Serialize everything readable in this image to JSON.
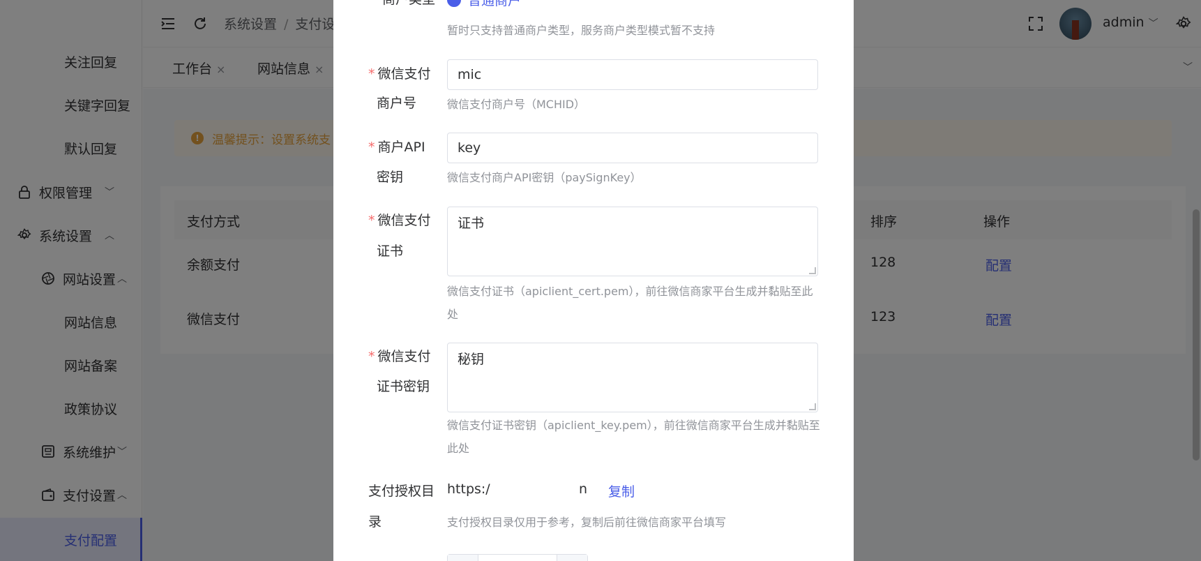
{
  "sidebar": {
    "items": [
      {
        "label": "关注回复"
      },
      {
        "label": "关键字回复"
      },
      {
        "label": "默认回复"
      },
      {
        "label": "权限管理"
      },
      {
        "label": "系统设置"
      },
      {
        "label": "网站设置"
      },
      {
        "label": "网站信息"
      },
      {
        "label": "网站备案"
      },
      {
        "label": "政策协议"
      },
      {
        "label": "系统维护"
      },
      {
        "label": "支付设置"
      },
      {
        "label": "支付配置"
      }
    ]
  },
  "header": {
    "breadcrumb": [
      "系统设置",
      "支付设"
    ],
    "breadcrumb_sep": "/",
    "user": "admin",
    "user_chevron": "﹀"
  },
  "tabs": [
    {
      "label": "工作台"
    },
    {
      "label": "网站信息"
    }
  ],
  "tab_close": "×",
  "alert": {
    "icon": "!",
    "text": "温馨提示：设置系统支"
  },
  "table": {
    "headers": {
      "method": "支付方式",
      "sort": "排序",
      "action": "操作"
    },
    "rows": [
      {
        "method": "余额支付",
        "sort": "128",
        "action": "配置"
      },
      {
        "method": "微信支付",
        "sort": "123",
        "action": "配置"
      }
    ]
  },
  "dialog": {
    "merchant_type": {
      "label": "商户类型",
      "option": "普通商户",
      "tip": "暂时只支持普通商户类型，服务商户类型模式暂不支持"
    },
    "required_mark": "*",
    "mchid": {
      "label_1": "微信支付",
      "label_2": "商户号",
      "value": "mic",
      "tip": "微信支付商户号（MCHID）"
    },
    "api_key": {
      "label_1": "商户API",
      "label_2": "密钥",
      "value": "key",
      "tip": "微信支付商户API密钥（paySignKey）"
    },
    "cert": {
      "label_1": "微信支付",
      "label_2": "证书",
      "value": "证书",
      "tip": "微信支付证书（apiclient_cert.pem），前往微信商家平台生成并黏贴至此处"
    },
    "cert_key": {
      "label_1": "微信支付",
      "label_2": "证书密钥",
      "value": "秘钥",
      "tip": "微信支付证书密钥（apiclient_key.pem），前往微信商家平台生成并黏贴至此处"
    },
    "auth_dir": {
      "label_1": "支付授权目",
      "label_2": "录",
      "url_start": "https:/",
      "url_end": "n",
      "copy": "复制",
      "tip": "支付授权目录仅用于参考，复制后前往微信商家平台填写"
    }
  },
  "colors": {
    "primary": "#4a5ee8",
    "required": "#f56c6c",
    "warning": "#e6a23c",
    "overlay": "rgba(0,0,0,0.5)"
  }
}
